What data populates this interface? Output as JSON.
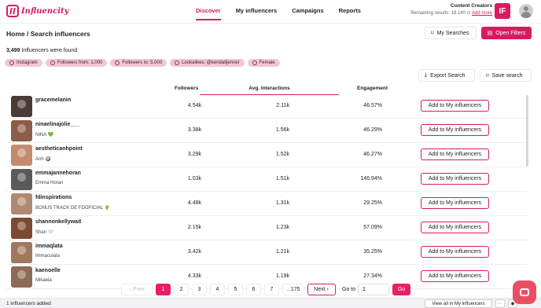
{
  "app": {
    "logo_text": "Influencity",
    "nav": [
      "Discover",
      "My influencers",
      "Campaigns",
      "Reports"
    ],
    "plan": "Content Creators",
    "remaining": "Remaining results: 19.140",
    "add_more": "Add more",
    "brand_initials": "IF"
  },
  "page": {
    "breadcrumb": "Home / Search influencers",
    "my_searches": "My Searches",
    "open_filters": "Open Filters",
    "count_value": "3,499",
    "count_label": "Influencers were found",
    "chips": [
      "Instagram",
      "Followers from: 1,000",
      "Followers to: 5,000",
      "Lookalikes: @kendalljenner",
      "Female"
    ],
    "export_search": "Export Search",
    "save_search": "Save search"
  },
  "table": {
    "columns": [
      "Followers",
      "Avg. Interactions",
      "Engagement"
    ],
    "add_label": "Add to My influencers",
    "rows": [
      {
        "handle": "gracemelanin",
        "sub": "",
        "followers": "4.54k",
        "interactions": "2.11k",
        "engagement": "46.57%",
        "color": "#4a3b37"
      },
      {
        "handle": "ninaelinajolie___",
        "sub": "NINA 💚",
        "followers": "3.38k",
        "interactions": "1.56k",
        "engagement": "46.29%",
        "color": "#8b5e4a"
      },
      {
        "handle": "aestheticanhpoint",
        "sub": "Anh 🥥",
        "followers": "3.29k",
        "interactions": "1.52k",
        "engagement": "46.27%",
        "color": "#c48a6c"
      },
      {
        "handle": "emmajannehoran",
        "sub": "Emma Horan",
        "followers": "1.03k",
        "interactions": "1.51k",
        "engagement": "146.94%",
        "color": "#5a5a5a"
      },
      {
        "handle": "fdinspirations",
        "sub": "BONUS TRACK DE FDOFICIAL 🌵",
        "followers": "4.48k",
        "interactions": "1.31k",
        "engagement": "29.25%",
        "color": "#b08a70"
      },
      {
        "handle": "shannonkellywait",
        "sub": "Shan 🤍",
        "followers": "2.15k",
        "interactions": "1.23k",
        "engagement": "57.09%",
        "color": "#7a4a32"
      },
      {
        "handle": "immaqlata",
        "sub": "Immaculata",
        "followers": "3.42k",
        "interactions": "1.21k",
        "engagement": "35.25%",
        "color": "#a0785c"
      },
      {
        "handle": "kaenoelle",
        "sub": "Mikaela",
        "followers": "4.33k",
        "interactions": "1.19k",
        "engagement": "27.34%",
        "color": "#8d6a58"
      }
    ]
  },
  "pagination": {
    "prev": "‹ Prev",
    "pages": [
      "1",
      "2",
      "3",
      "4",
      "5",
      "6",
      "7",
      "...175"
    ],
    "next": "Next ›",
    "goto_label": "Go to",
    "goto_value": "1",
    "go": "Go"
  },
  "footer": {
    "added": "1 influencers added",
    "view_all": "View all in My influencers",
    "more": "···",
    "eye": "◉"
  }
}
